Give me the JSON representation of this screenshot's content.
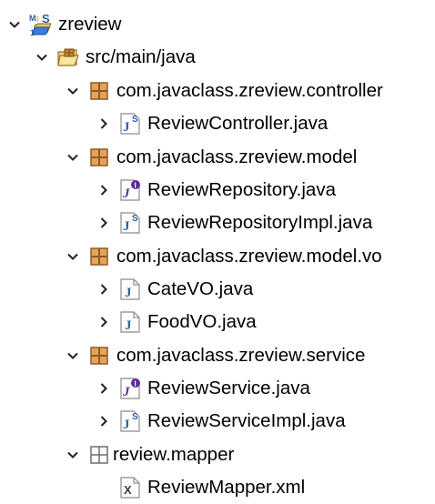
{
  "project": {
    "name": "zreview",
    "icon": "maven-java-project-icon"
  },
  "source_folder": {
    "name": "src/main/java",
    "icon": "source-folder-icon"
  },
  "packages": [
    {
      "name": "com.javaclass.zreview.controller",
      "files": [
        {
          "name": "ReviewController.java",
          "icon": "java-class-icon"
        }
      ]
    },
    {
      "name": "com.javaclass.zreview.model",
      "files": [
        {
          "name": "ReviewRepository.java",
          "icon": "java-interface-icon"
        },
        {
          "name": "ReviewRepositoryImpl.java",
          "icon": "java-class-icon"
        }
      ]
    },
    {
      "name": "com.javaclass.zreview.model.vo",
      "files": [
        {
          "name": "CateVO.java",
          "icon": "java-file-icon"
        },
        {
          "name": "FoodVO.java",
          "icon": "java-file-icon"
        }
      ]
    },
    {
      "name": "com.javaclass.zreview.service",
      "files": [
        {
          "name": "ReviewService.java",
          "icon": "java-interface-icon"
        },
        {
          "name": "ReviewServiceImpl.java",
          "icon": "java-class-icon"
        }
      ]
    }
  ],
  "resource_folder": {
    "name": "review.mapper",
    "files": [
      {
        "name": "ReviewMapper.xml",
        "icon": "xml-file-icon"
      }
    ]
  },
  "colors": {
    "package": "#8f5a24",
    "java": "#2d5fa6",
    "spring": "#6a9a2a"
  }
}
